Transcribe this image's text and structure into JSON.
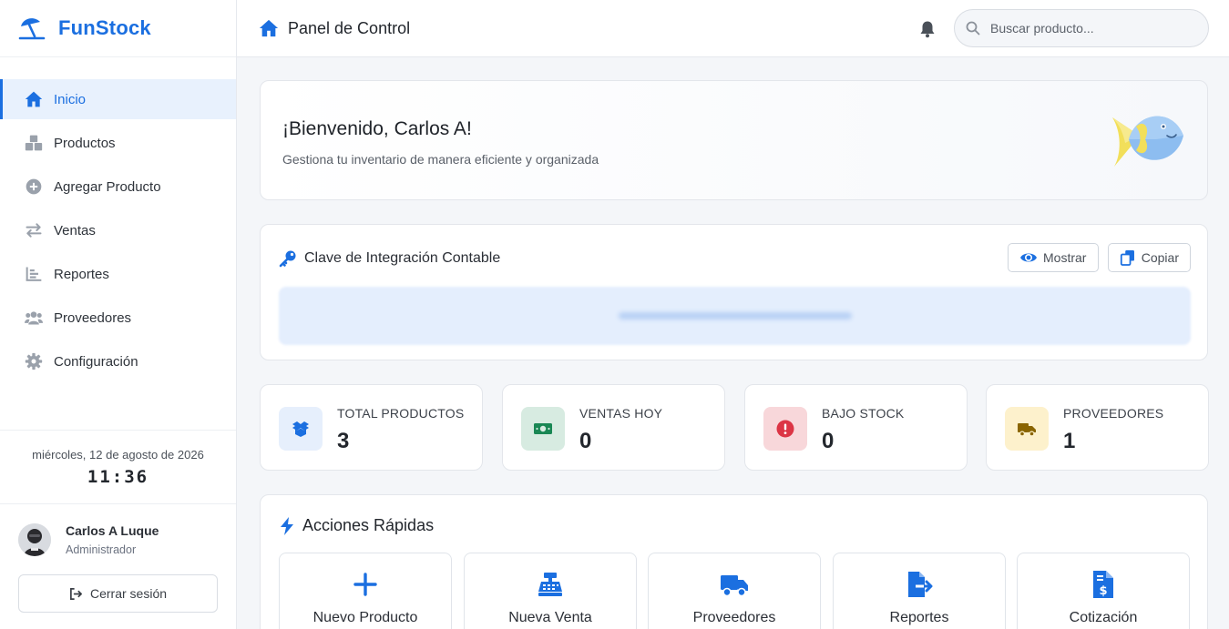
{
  "brand": {
    "name": "FunStock"
  },
  "sidebar": {
    "items": [
      {
        "label": "Inicio",
        "icon": "home-icon",
        "active": true
      },
      {
        "label": "Productos",
        "icon": "boxes-icon",
        "active": false
      },
      {
        "label": "Agregar Producto",
        "icon": "plus-circle-icon",
        "active": false
      },
      {
        "label": "Ventas",
        "icon": "exchange-icon",
        "active": false
      },
      {
        "label": "Reportes",
        "icon": "bar-chart-icon",
        "active": false
      },
      {
        "label": "Proveedores",
        "icon": "users-icon",
        "active": false
      },
      {
        "label": "Configuración",
        "icon": "gear-icon",
        "active": false
      }
    ],
    "date": "miércoles, 12 de agosto de 2026",
    "time": "11:36",
    "user": {
      "name": "Carlos A Luque",
      "role": "Administrador"
    },
    "logout_label": "Cerrar sesión"
  },
  "header": {
    "title": "Panel de Control",
    "search_placeholder": "Buscar producto..."
  },
  "welcome": {
    "title": "¡Bienvenido, Carlos A!",
    "subtitle": "Gestiona tu inventario de manera eficiente y organizada"
  },
  "integration": {
    "title": "Clave de Integración Contable",
    "show_label": "Mostrar",
    "copy_label": "Copiar"
  },
  "stats": [
    {
      "label": "TOTAL PRODUCTOS",
      "value": "3",
      "icon": "box-open-icon",
      "color": "#1b6fe0",
      "bg": "#e6effc"
    },
    {
      "label": "VENTAS HOY",
      "value": "0",
      "icon": "money-bill-icon",
      "color": "#198754",
      "bg": "#d7ebe1"
    },
    {
      "label": "BAJO STOCK",
      "value": "0",
      "icon": "alert-circle-icon",
      "color": "#dc3545",
      "bg": "#f8d7da"
    },
    {
      "label": "PROVEEDORES",
      "value": "1",
      "icon": "truck-icon",
      "color": "#8a6500",
      "bg": "#fdf1cc"
    }
  ],
  "quick_actions": {
    "title": "Acciones Rápidas",
    "items": [
      {
        "label": "Nuevo Producto",
        "icon": "plus-icon"
      },
      {
        "label": "Nueva Venta",
        "icon": "cash-register-icon"
      },
      {
        "label": "Proveedores",
        "icon": "truck-icon"
      },
      {
        "label": "Reportes",
        "icon": "file-export-icon"
      },
      {
        "label": "Cotización",
        "icon": "invoice-dollar-icon"
      }
    ]
  },
  "colors": {
    "accent": "#1b6fe0",
    "muted_icon": "#9aa1ab"
  }
}
